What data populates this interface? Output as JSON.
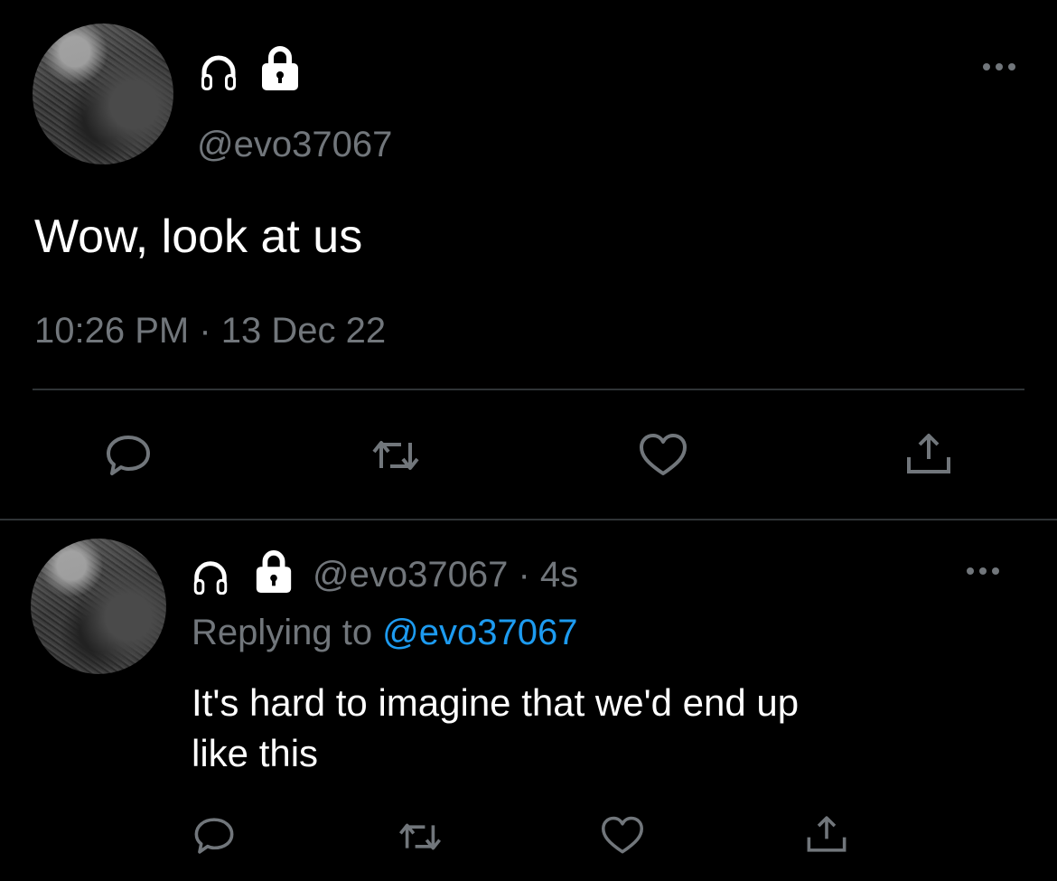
{
  "main_tweet": {
    "handle": "@evo37067",
    "text": "Wow, look at us",
    "timestamp": "10:26 PM · 13 Dec 22",
    "icons": [
      "headphones-icon",
      "lock-icon",
      "more-icon"
    ],
    "actions": [
      "reply-icon",
      "retweet-icon",
      "like-icon",
      "share-icon"
    ]
  },
  "reply_tweet": {
    "handle": "@evo37067",
    "separator": " · ",
    "time": "4s",
    "replying_label": "Replying to",
    "replying_handle": "@evo37067",
    "text_line1": "It's hard to imagine that we'd end up",
    "text_line2": "like this",
    "icons": [
      "headphones-icon",
      "lock-icon",
      "more-icon"
    ],
    "actions": [
      "reply-icon",
      "retweet-icon",
      "like-icon",
      "share-icon"
    ]
  },
  "colors": {
    "background": "#000000",
    "text": "#e7e9ea",
    "muted": "#71767b",
    "link": "#1d9bf0",
    "divider": "#2f3336"
  }
}
